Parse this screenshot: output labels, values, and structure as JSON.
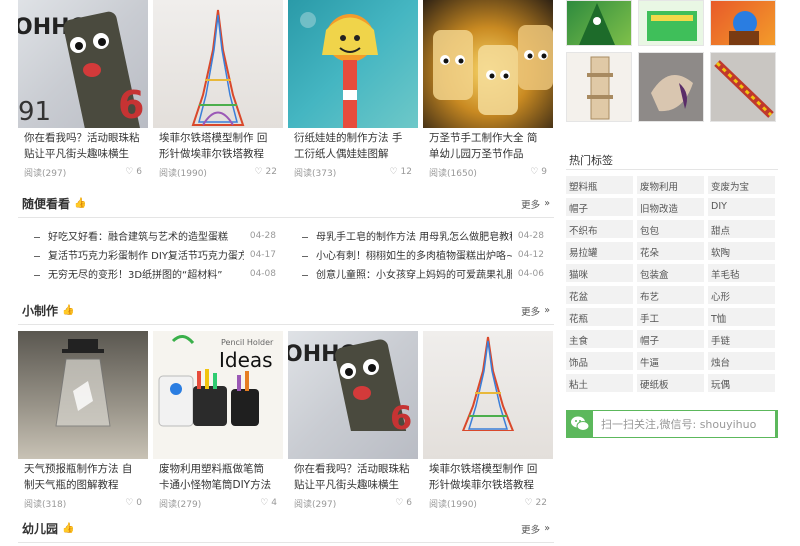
{
  "top_cards": [
    {
      "title": "你在看我吗？活动眼珠粘贴让平凡街头趣味横生",
      "views": "阅读(297)",
      "likes": "6"
    },
    {
      "title": "埃菲尔铁塔模型制作 回形针做埃菲尔铁塔教程",
      "views": "阅读(1990)",
      "likes": "22"
    },
    {
      "title": "衍纸娃娃的制作方法 手工衍纸人偶娃娃图解",
      "views": "阅读(373)",
      "likes": "12"
    },
    {
      "title": "万圣节手工制作大全 简单幼儿园万圣节作品",
      "views": "阅读(1650)",
      "likes": "9"
    }
  ],
  "random_section": {
    "title": "随便看看",
    "more": "更多",
    "left": [
      {
        "title": "好吃又好看：融合建筑与艺术的造型蛋糕",
        "date": "04-28"
      },
      {
        "title": "复活节巧克力彩蛋制作 DIY复活节巧克力蛋方法",
        "date": "04-17"
      },
      {
        "title": "无穷无尽的变形！3D纸拼图的“超材料”",
        "date": "04-08"
      }
    ],
    "right": [
      {
        "title": "母乳手工皂的制作方法 用母乳怎么做肥皂教程",
        "date": "04-28"
      },
      {
        "title": "小心有刺！栩栩如生的多肉植物蛋糕出炉咯~",
        "date": "04-12"
      },
      {
        "title": "创意儿童照：小女孩穿上妈妈的可爱蔬果礼服",
        "date": "04-06"
      }
    ]
  },
  "craft_section": {
    "title": "小制作",
    "more": "更多",
    "cards": [
      {
        "title": "天气预报瓶制作方法 自制天气瓶的图解教程",
        "views": "阅读(318)",
        "likes": "0"
      },
      {
        "title": "废物利用塑料瓶做笔筒 卡通小怪物笔筒DIY方法",
        "views": "阅读(279)",
        "likes": "4"
      },
      {
        "title": "你在看我吗？活动眼珠粘贴让平凡街头趣味横生",
        "views": "阅读(297)",
        "likes": "6"
      },
      {
        "title": "埃菲尔铁塔模型制作 回形针做埃菲尔铁塔教程",
        "views": "阅读(1990)",
        "likes": "22"
      }
    ],
    "pencil_holder": {
      "line1": "Pencil Holder",
      "line2": "Ideas"
    }
  },
  "kinder_section": {
    "title": "幼儿园",
    "more": "更多"
  },
  "sidebar": {
    "tags_title": "热门标签",
    "tags": [
      "塑料瓶",
      "废物利用",
      "变废为宝",
      "帽子",
      "旧物改造",
      "DIY",
      "不织布",
      "包包",
      "甜点",
      "易拉罐",
      "花朵",
      "软陶",
      "猫咪",
      "包装盒",
      "羊毛毡",
      "花盆",
      "布艺",
      "心形",
      "花瓶",
      "手工",
      "T恤",
      "主食",
      "帽子",
      "手链",
      "饰品",
      "牛逼",
      "烛台",
      "粘土",
      "硬纸板",
      "玩偶"
    ],
    "wechat": "扫一扫关注,微信号: shouyihuo"
  },
  "colors": {
    "accent": "#5cb85c",
    "border": "#e5e5e5",
    "tag_bg": "#f2f2f2"
  }
}
